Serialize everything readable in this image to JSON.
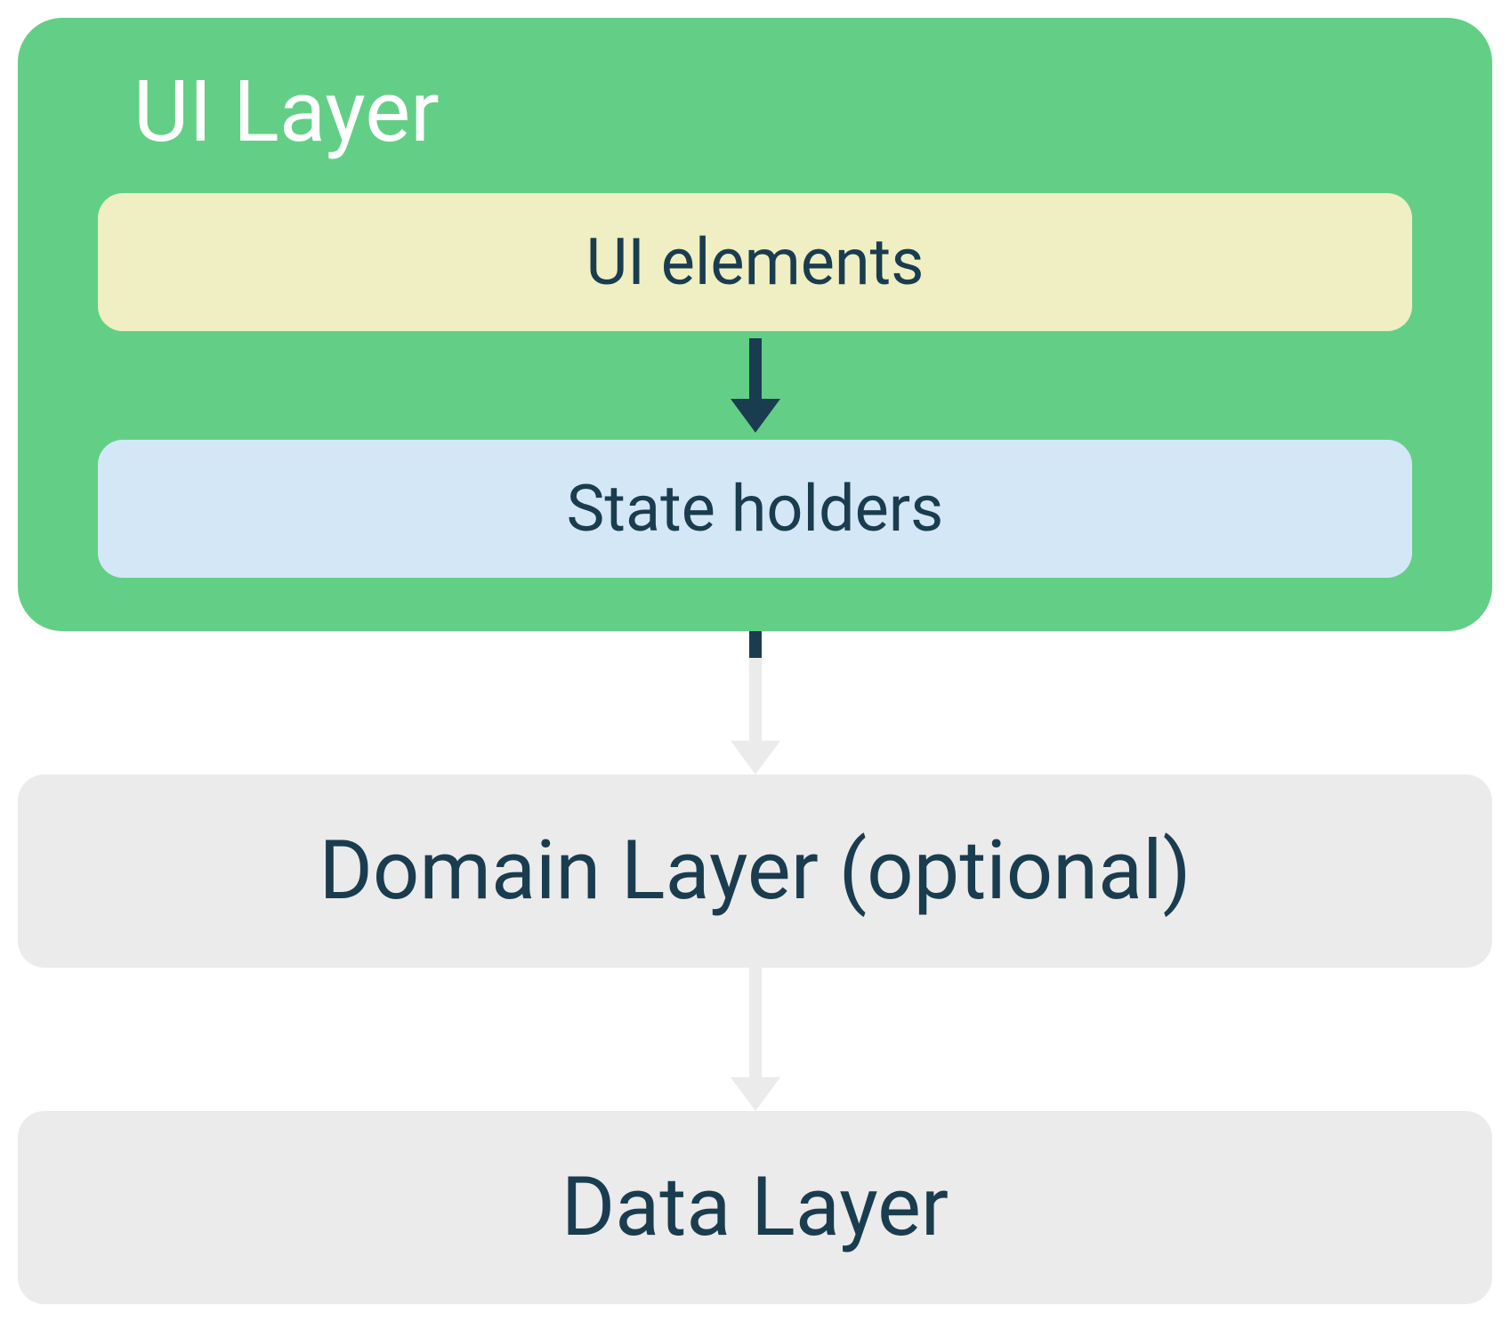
{
  "ui_layer": {
    "title": "UI Layer",
    "ui_elements_label": "UI elements",
    "state_holders_label": "State holders"
  },
  "domain_layer": {
    "label": "Domain Layer (optional)"
  },
  "data_layer": {
    "label": "Data Layer"
  },
  "colors": {
    "ui_layer_bg": "#63cf86",
    "ui_elements_bg": "#efefc3",
    "state_holders_bg": "#d4e7f7",
    "layer_box_bg": "#ebebeb",
    "text_dark": "#1a3c4f",
    "text_light": "#ffffff",
    "arrow_dark": "#1a3c4f",
    "arrow_light": "#ebebeb"
  }
}
